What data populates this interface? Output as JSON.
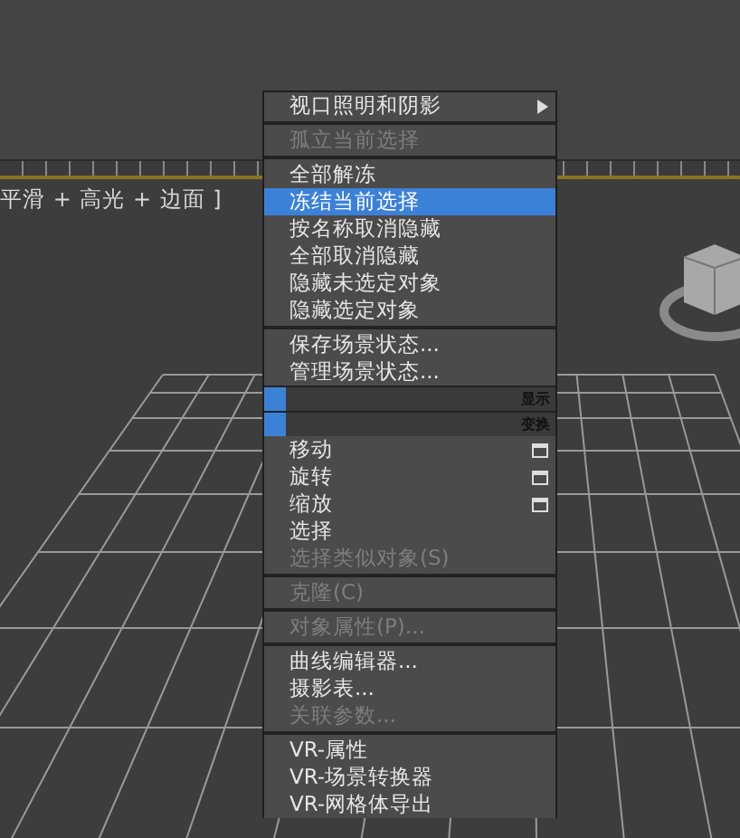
{
  "viewport": {
    "label": "平滑 + 高光 + 边面 ]"
  },
  "menu": [
    {
      "kind": "item",
      "label": "视口照明和阴影",
      "disabled": false,
      "selected": false,
      "submenu": true,
      "option_box": false
    },
    {
      "kind": "separator"
    },
    {
      "kind": "item",
      "label": "孤立当前选择",
      "disabled": true,
      "selected": false,
      "submenu": false,
      "option_box": false
    },
    {
      "kind": "separator"
    },
    {
      "kind": "item",
      "label": "全部解冻",
      "disabled": false,
      "selected": false,
      "submenu": false,
      "option_box": false
    },
    {
      "kind": "item",
      "label": "冻结当前选择",
      "disabled": false,
      "selected": true,
      "submenu": false,
      "option_box": false
    },
    {
      "kind": "item",
      "label": "按名称取消隐藏",
      "disabled": false,
      "selected": false,
      "submenu": false,
      "option_box": false
    },
    {
      "kind": "item",
      "label": "全部取消隐藏",
      "disabled": false,
      "selected": false,
      "submenu": false,
      "option_box": false
    },
    {
      "kind": "item",
      "label": "隐藏未选定对象",
      "disabled": false,
      "selected": false,
      "submenu": false,
      "option_box": false
    },
    {
      "kind": "item",
      "label": "隐藏选定对象",
      "disabled": false,
      "selected": false,
      "submenu": false,
      "option_box": false
    },
    {
      "kind": "separator"
    },
    {
      "kind": "item",
      "label": "保存场景状态...",
      "disabled": false,
      "selected": false,
      "submenu": false,
      "option_box": false
    },
    {
      "kind": "item",
      "label": "管理场景状态...",
      "disabled": false,
      "selected": false,
      "submenu": false,
      "option_box": false
    },
    {
      "kind": "header",
      "label": "显示"
    },
    {
      "kind": "header",
      "label": "变换"
    },
    {
      "kind": "item",
      "label": "移动",
      "disabled": false,
      "selected": false,
      "submenu": false,
      "option_box": true
    },
    {
      "kind": "item",
      "label": "旋转",
      "disabled": false,
      "selected": false,
      "submenu": false,
      "option_box": true
    },
    {
      "kind": "item",
      "label": "缩放",
      "disabled": false,
      "selected": false,
      "submenu": false,
      "option_box": true
    },
    {
      "kind": "item",
      "label": "选择",
      "disabled": false,
      "selected": false,
      "submenu": false,
      "option_box": false
    },
    {
      "kind": "item",
      "label": "选择类似对象(S)",
      "disabled": true,
      "selected": false,
      "submenu": false,
      "option_box": false
    },
    {
      "kind": "separator"
    },
    {
      "kind": "item",
      "label": "克隆(C)",
      "disabled": true,
      "selected": false,
      "submenu": false,
      "option_box": false
    },
    {
      "kind": "separator"
    },
    {
      "kind": "item",
      "label": "对象属性(P)...",
      "disabled": true,
      "selected": false,
      "submenu": false,
      "option_box": false
    },
    {
      "kind": "separator"
    },
    {
      "kind": "item",
      "label": "曲线编辑器...",
      "disabled": false,
      "selected": false,
      "submenu": false,
      "option_box": false
    },
    {
      "kind": "item",
      "label": "摄影表...",
      "disabled": false,
      "selected": false,
      "submenu": false,
      "option_box": false
    },
    {
      "kind": "item",
      "label": "关联参数...",
      "disabled": true,
      "selected": false,
      "submenu": false,
      "option_box": false
    },
    {
      "kind": "separator"
    },
    {
      "kind": "item",
      "label": "VR-属性",
      "disabled": false,
      "selected": false,
      "submenu": false,
      "option_box": false
    },
    {
      "kind": "item",
      "label": "VR-场景转换器",
      "disabled": false,
      "selected": false,
      "submenu": false,
      "option_box": false
    },
    {
      "kind": "item",
      "label": "VR-网格体导出",
      "disabled": false,
      "selected": false,
      "submenu": false,
      "option_box": false
    }
  ]
}
